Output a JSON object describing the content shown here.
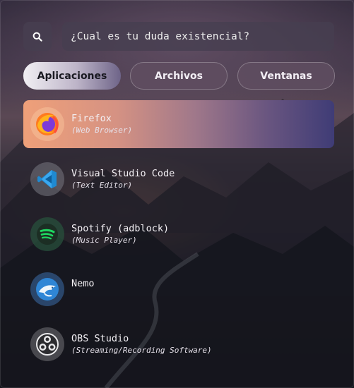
{
  "search": {
    "placeholder": "¿Cual es tu duda existencial?",
    "icon": "search-icon"
  },
  "tabs": [
    {
      "label": "Aplicaciones",
      "active": true
    },
    {
      "label": "Archivos",
      "active": false
    },
    {
      "label": "Ventanas",
      "active": false
    }
  ],
  "apps": [
    {
      "name": "Firefox",
      "description": "(Web Browser)",
      "icon": "firefox-icon",
      "selected": true
    },
    {
      "name": "Visual Studio Code",
      "description": "(Text Editor)",
      "icon": "vscode-icon",
      "selected": false
    },
    {
      "name": "Spotify (adblock)",
      "description": "(Music Player)",
      "icon": "spotify-icon",
      "selected": false
    },
    {
      "name": "Nemo",
      "description": "",
      "icon": "nemo-icon",
      "selected": false
    },
    {
      "name": "OBS Studio",
      "description": "(Streaming/Recording Software)",
      "icon": "obs-icon",
      "selected": false
    }
  ],
  "colors": {
    "selected_gradient_start": "#efa079",
    "selected_gradient_end": "#3f3c76",
    "active_tab": "#f1eff3"
  }
}
